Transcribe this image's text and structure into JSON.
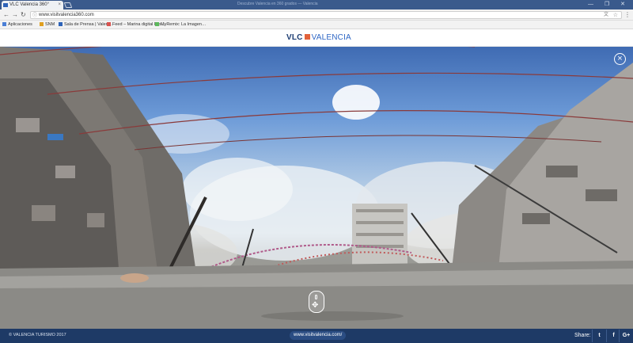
{
  "browser": {
    "tab_title": "VLC Valencia 360°",
    "tab_close": "×",
    "window_title": "Descubre Valencia en 360 grados — Valencia",
    "window_controls": "— ❐ ✕",
    "url": "www.visitvalencia360.com",
    "bookmarks": [
      {
        "label": "Aplicaciones",
        "icon": "apps-icon",
        "color": "#4a7fd6"
      },
      {
        "label": "SNM",
        "icon": "bookmark-icon",
        "color": "#e0a020"
      },
      {
        "label": "Sala de Prensa | Valen…",
        "icon": "bookmark-icon",
        "color": "#2e63b8"
      },
      {
        "label": "Feed – Marina digital Pro…",
        "icon": "bookmark-icon",
        "color": "#d9534f"
      },
      {
        "label": "MyRemix: La Imagen…",
        "icon": "bookmark-icon",
        "color": "#5cb85c"
      }
    ]
  },
  "header": {
    "logo_vlc": "VLC",
    "logo_valencia": "VALENCIA",
    "logo_accent": "#e2623b"
  },
  "viewer": {
    "close_label": "×",
    "move_hint_icon": "drag-mouse-icon",
    "move_glyph": "✥"
  },
  "footer": {
    "copyright": "© VALENCIA TURISMO 2017",
    "site_link": "www.visitvalencia.com/",
    "share_label": "Share:",
    "social": [
      {
        "name": "twitter-icon",
        "glyph": "t"
      },
      {
        "name": "facebook-icon",
        "glyph": "f"
      },
      {
        "name": "google-plus-icon",
        "glyph": "G+"
      }
    ]
  }
}
